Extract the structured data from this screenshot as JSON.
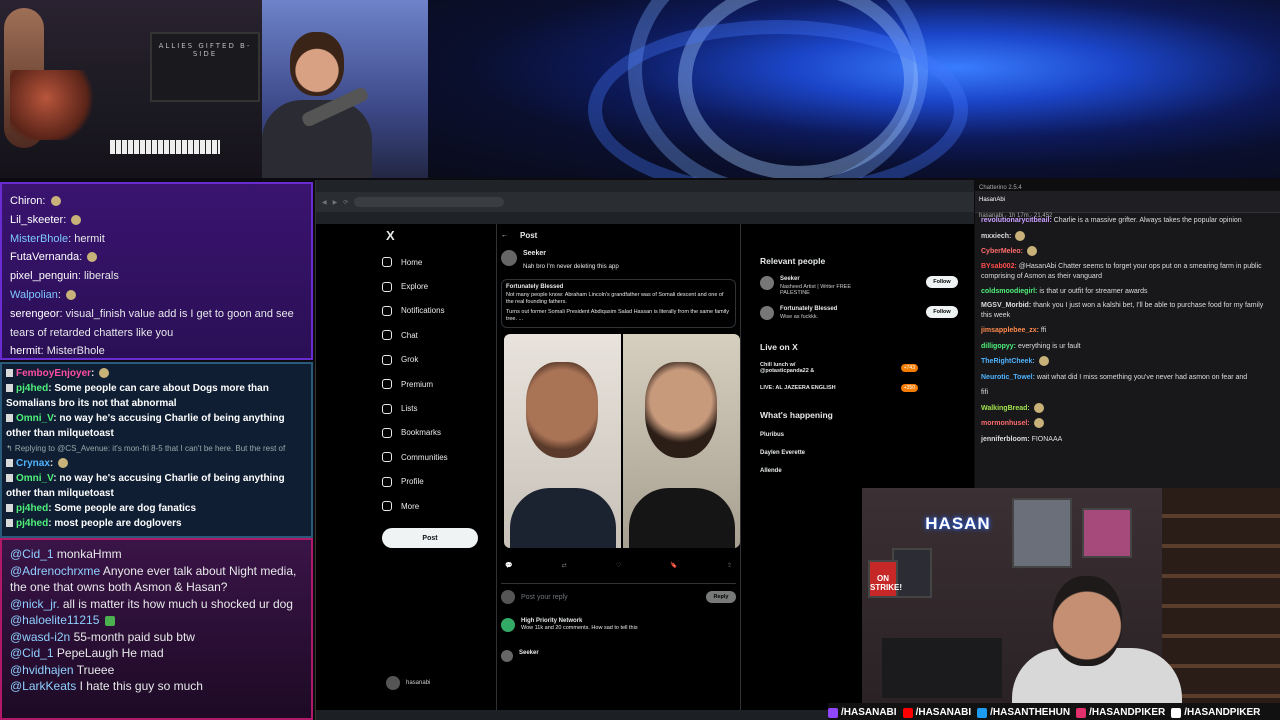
{
  "chat_top": [
    {
      "user": "Chiron",
      "msg": "",
      "color": "#ffffff"
    },
    {
      "user": "Lil_skeeter",
      "msg": "",
      "color": "#ffffff"
    },
    {
      "user": "MisterBhole",
      "msg": "hermit",
      "color": "#7ec8ff"
    },
    {
      "user": "FutaVernanda",
      "msg": "",
      "color": "#ffffff"
    },
    {
      "user": "pixel_penguin",
      "msg": "liberals",
      "color": "#ffffff"
    },
    {
      "user": "Walpolian",
      "msg": "",
      "color": "#7ec8ff"
    },
    {
      "user": "serengeor",
      "msg": "visual_finish value add is I get to goon and see tears of retarded chatters like you",
      "color": "#ffffff"
    },
    {
      "user": "hermit",
      "msg": "MisterBhole",
      "color": "#ffffff"
    }
  ],
  "chat_mid": [
    {
      "user": "FemboyEnjoyer",
      "msg": "",
      "color": "#ff4da6"
    },
    {
      "user": "pj4hed",
      "msg": "Some people can care about Dogs more than Somalians bro its not that abnormal",
      "color": "#4ef07a"
    },
    {
      "user": "Omni_V",
      "msg": "no way he's accusing Charlie of being anything other than milquetoast",
      "color": "#4ef07a"
    },
    {
      "user": "",
      "msg": "↰ Replying to @CS_Avenue: it's mon-fri 8-5 that I can't be here. But the rest of",
      "color": "#9aa"
    },
    {
      "user": "Crynax",
      "msg": "",
      "color": "#4fb3ff"
    },
    {
      "user": "Omni_V",
      "msg": "no way he's accusing Charlie of being anything other than milquetoast",
      "color": "#4ef07a"
    },
    {
      "user": "pj4hed",
      "msg": "Some people are dog fanatics",
      "color": "#4ef07a"
    },
    {
      "user": "pj4hed",
      "msg": "most people are doglovers",
      "color": "#4ef07a"
    }
  ],
  "chat_bot": [
    {
      "user": "@Cid_1",
      "msg": "monkaHmm",
      "color": "#8fd0ff"
    },
    {
      "user": "@Adrenochrxme",
      "msg": "Anyone ever talk about Night media, the one that owns both Asmon & Hasan?",
      "color": "#8fd0ff"
    },
    {
      "user": "@nick_jr.",
      "msg": "all is matter its how much u shocked ur dog",
      "color": "#8fd0ff"
    },
    {
      "user": "@haloelite11215",
      "msg": "",
      "color": "#8fd0ff"
    },
    {
      "user": "@wasd-i2n",
      "msg": "55-month paid sub btw",
      "color": "#8fd0ff"
    },
    {
      "user": "@Cid_1",
      "msg": "PepeLaugh He mad",
      "color": "#8fd0ff"
    },
    {
      "user": "@hvidhajen",
      "msg": "Trueee",
      "color": "#8fd0ff"
    },
    {
      "user": "@LarkKeats",
      "msg": "I hate this guy so much",
      "color": "#8fd0ff"
    }
  ],
  "x_nav": {
    "logo": "X",
    "items": [
      {
        "label": "Home",
        "icon": "home-icon"
      },
      {
        "label": "Explore",
        "icon": "search-icon"
      },
      {
        "label": "Notifications",
        "icon": "bell-icon"
      },
      {
        "label": "Chat",
        "icon": "chat-icon"
      },
      {
        "label": "Grok",
        "icon": "grok-icon"
      },
      {
        "label": "Premium",
        "icon": "x-icon"
      },
      {
        "label": "Lists",
        "icon": "list-icon"
      },
      {
        "label": "Bookmarks",
        "icon": "bookmark-icon"
      },
      {
        "label": "Communities",
        "icon": "people-icon"
      },
      {
        "label": "Profile",
        "icon": "person-icon"
      },
      {
        "label": "More",
        "icon": "more-icon"
      }
    ],
    "post_button": "Post",
    "account_name": "hasanabi"
  },
  "feed": {
    "header": "Post",
    "author": "Seeker",
    "post_text": "Nah bro I'm never deleting this app",
    "quoted_author": "Fortunately Blessed",
    "quoted_text1": "Not many people know: Abraham Lincoln's grandfather was of Somali descent and one of the real founding fathers.",
    "quoted_text2": "Turns out former Somali President Abdiqasim Salad Hassan is literally from the same family tree. ...",
    "reply_placeholder": "Post your reply",
    "reply_button": "Reply",
    "reply1_author": "High Priority Network",
    "reply1_text": "Wow 11k and 20 comments. How sad to tell this",
    "reply2_author": "Seeker"
  },
  "right_col": {
    "relevant": "Relevant people",
    "people": [
      {
        "name": "Seeker",
        "bio": "Nasheed Artist | Writer FREE PALESTINE",
        "btn": "Follow"
      },
      {
        "name": "Fortunately Blessed",
        "bio": "Wise as fuckkk.",
        "btn": "Follow"
      }
    ],
    "live": "Live on X",
    "live_items": [
      {
        "name": "Chill lunch w/ @potasticpanda22 &",
        "count": "+743"
      },
      {
        "name": "LIVE: AL JAZEERA ENGLISH",
        "count": "+350"
      }
    ],
    "happening": "What's happening",
    "trends": [
      {
        "label": "Pluribus"
      },
      {
        "label": "Daylen Everette"
      },
      {
        "label": "Allende"
      }
    ]
  },
  "rchat": {
    "header": "Chatterino 2.5.4",
    "tab": "HasanAbi",
    "stream_info": "hasanabi · 1h 17m · 21,452",
    "lines": [
      {
        "user": "revolutionarycitbeail:",
        "msg": "Charlie is a massive grifter. Always takes the popular opinion",
        "color": "#c9a0ff"
      },
      {
        "user": "mxxiech:",
        "msg": "",
        "color": "#ddd"
      },
      {
        "user": "CyberMeleo:",
        "msg": "",
        "color": "#ff6b6b"
      },
      {
        "user": "BYsab002:",
        "msg": "@HasanAbi Chatter seems to forget your ops put on a smearing farm in public comprising of Asmon as their vanguard",
        "color": "#ff4d4d"
      },
      {
        "user": "coldsmoodiegirl:",
        "msg": "is that ur outfit for streamer awards",
        "color": "#4ef07a"
      },
      {
        "user": "MGSV_Morbid:",
        "msg": "thank you I just won a kalshi bet, I'll be able to purchase food for my family this week",
        "color": "#ddd"
      },
      {
        "user": "jimsapplebee_zx:",
        "msg": "ffi",
        "color": "#ff8a4d"
      },
      {
        "user": "dilligopyy:",
        "msg": "everything is ur fault",
        "color": "#4ef07a"
      },
      {
        "user": "TheRightCheek:",
        "msg": "",
        "color": "#4fb3ff"
      },
      {
        "user": "Neurotic_Towel:",
        "msg": "wait what did I miss something you've never had asmon on fear and",
        "color": "#4fb3ff"
      },
      {
        "user": "",
        "msg": "fifi",
        "color": "#ddd"
      },
      {
        "user": "WalkingBread:",
        "msg": "",
        "color": "#a0e04d"
      },
      {
        "user": "mormonhusel:",
        "msg": "",
        "color": "#ff6b6b"
      },
      {
        "user": "jenniferbloom:",
        "msg": "FIONAAA",
        "color": "#ddd"
      }
    ]
  },
  "overlay": {
    "logo": "HASAN",
    "ticker": [
      {
        "label": "/HASANABI",
        "color": "#9146ff"
      },
      {
        "label": "/HASANABI",
        "color": "#ff0000"
      },
      {
        "label": "/HASANTHEHUN",
        "color": "#1d9bf0"
      },
      {
        "label": "/HASANDPIKER",
        "color": "#e1306c"
      },
      {
        "label": "/HASANDPIKER",
        "color": "#ffffff"
      }
    ]
  },
  "poster_text": "ALLIES GIFTED B-SIDE",
  "strike_text": "ON STRIKE!"
}
